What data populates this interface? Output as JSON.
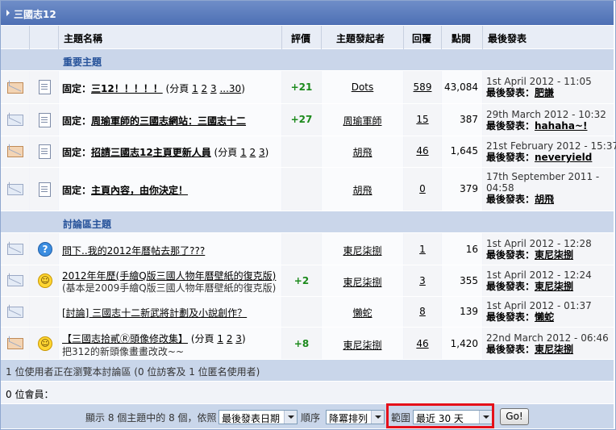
{
  "forum": {
    "title": "三國志12"
  },
  "header": {
    "topic": "主題名稱",
    "rating": "評價",
    "starter": "主題發起者",
    "replies": "回覆",
    "views": "點閱",
    "last_post": "最後發表"
  },
  "sections": [
    {
      "label": "重要主題"
    },
    {
      "label": "討論區主題"
    }
  ],
  "threads": [
    {
      "prefix": "固定：",
      "title": "三12！！！！！",
      "pages_prefix": "(分頁",
      "pages": [
        "1",
        "2",
        "3",
        "...30"
      ],
      "pages_suffix": ")",
      "rating": "+21",
      "starter": "Dots",
      "replies": "589",
      "views": "43,084",
      "last_date": "1st April 2012 - 11:05",
      "last_by_label": "最後發表：",
      "last_by": "肥謙"
    },
    {
      "prefix": "固定：",
      "title": "周瑜軍師的三國志網站：三國志十二",
      "rating": "+27",
      "starter": "周瑜軍師",
      "replies": "15",
      "views": "387",
      "last_date": "29th March 2012 - 10:32",
      "last_by_label": "最後發表：",
      "last_by": "hahaha~!"
    },
    {
      "prefix": "固定：",
      "title": "招請三國志12主頁更新人員",
      "pages_prefix": "(分頁",
      "pages": [
        "1",
        "2",
        "3"
      ],
      "pages_suffix": ")",
      "rating": "",
      "starter": "胡飛",
      "replies": "46",
      "views": "1,645",
      "last_date": "21st February 2012 - 15:37",
      "last_by_label": "最後發表：",
      "last_by": "neveryield"
    },
    {
      "prefix": "固定：",
      "title": "主頁內容，由你決定！",
      "rating": "",
      "starter": "胡飛",
      "replies": "0",
      "views": "379",
      "last_date_1": "17th September 2011 -",
      "last_date_2": "04:58",
      "last_by_label": "最後發表：",
      "last_by": "胡飛"
    },
    {
      "title": "問下..我的2012年曆帖去那了???",
      "rating": "",
      "starter": "東尼柒捌",
      "replies": "1",
      "views": "16",
      "last_date": "1st April 2012 - 12:28",
      "last_by_label": "最後發表：",
      "last_by": "東尼柒捌"
    },
    {
      "title": "2012年年歷(手繪Q版三國人物年曆壁紙的復克版)",
      "description": "(基本是2009手繪Q版三國人物年曆壁紙的復克版)",
      "rating": "+2",
      "starter": "東尼柒捌",
      "replies": "3",
      "views": "355",
      "last_date": "1st April 2012 - 12:24",
      "last_by_label": "最後發表：",
      "last_by": "東尼柒捌"
    },
    {
      "title": "[討論] 三國志十二新武將計劃及小說創作？",
      "rating": "",
      "starter": "懶蛇",
      "replies": "8",
      "views": "139",
      "last_date": "1st April 2012 - 01:37",
      "last_by_label": "最後發表：",
      "last_by": "懶蛇"
    },
    {
      "title": "【三國志拾貳Ⓡ頭像修改集】",
      "pages_prefix": "(分頁",
      "pages": [
        "1",
        "2",
        "3"
      ],
      "pages_suffix": ")",
      "description": "把312的新頭像畫畫改改~~",
      "rating": "+8",
      "starter": "東尼柒捌",
      "replies": "46",
      "views": "1,420",
      "last_date": "22nd March 2012 - 06:46",
      "last_by_label": "最後發表：",
      "last_by": "東尼柒捌"
    }
  ],
  "footer": {
    "online_text": "1 位使用者正在瀏覽本討論區 (0 位訪客及 1 位匿名使用者)",
    "members_text": "0 位會員：",
    "showing_text": "顯示 8 個主題中的 8 個，依照",
    "sort_by": "最後發表日期",
    "order_label": "順序",
    "order": "降冪排列",
    "range_label": "範圍",
    "range": "最近 30 天",
    "go_label": "Go!"
  },
  "colors": {
    "title_bar": "#4d6fb4",
    "section_bar": "#cad6ea",
    "highlight": "#e5101a",
    "rating_positive": "#1c8a1c"
  }
}
